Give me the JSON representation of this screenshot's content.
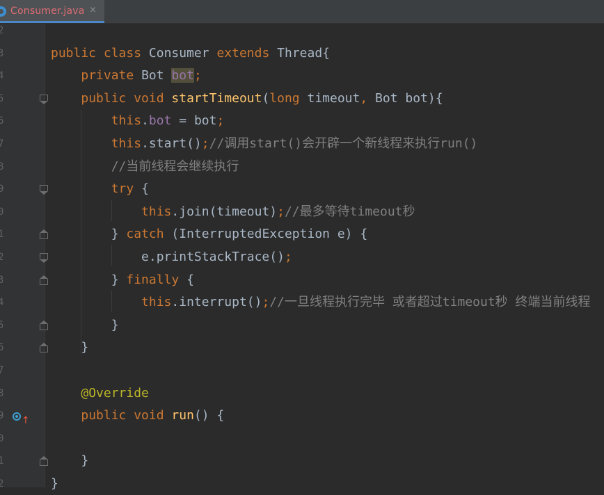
{
  "tab": {
    "label": "Consumer.java",
    "close": "×"
  },
  "lines": [
    {
      "num": "2",
      "html": ""
    },
    {
      "num": "3",
      "html": "<span class=\"kw\">public class </span><span class=\"cls\">Consumer </span><span class=\"kw\">extends </span><span class=\"ty\">Thread</span>{"
    },
    {
      "num": "4",
      "html": "    <span class=\"kw\">private </span><span class=\"ty\">Bot </span><span class=\"fld hl\">bot</span><span class=\"kw\">;</span>"
    },
    {
      "num": "5",
      "html": "    <span class=\"kw\">public void </span><span class=\"mth\">startTimeout</span>(<span class=\"kw\">long </span>timeout<span class=\"kw\">, </span><span class=\"ty\">Bot </span>bot){"
    },
    {
      "num": "6",
      "html": "        <span class=\"kw\">this</span>.<span class=\"fld\">bot </span>= bot<span class=\"kw\">;</span>"
    },
    {
      "num": "7",
      "html": "        <span class=\"kw\">this</span>.start()<span class=\"kw\">;</span><span class=\"cm\">//调用start()会开辟一个新线程来执行run()</span>"
    },
    {
      "num": "8",
      "html": "        <span class=\"cm\">//当前线程会继续执行</span>"
    },
    {
      "num": "9",
      "html": "        <span class=\"kw\">try </span>{"
    },
    {
      "num": "0",
      "html": "            <span class=\"kw\">this</span>.join(timeout)<span class=\"kw\">;</span><span class=\"cm\">//最多等待timeout秒</span>"
    },
    {
      "num": "1",
      "html": "        } <span class=\"kw\">catch </span>(<span class=\"ty\">InterruptedException </span>e) {"
    },
    {
      "num": "2",
      "html": "            e.printStackTrace()<span class=\"kw\">;</span>"
    },
    {
      "num": "3",
      "html": "        } <span class=\"kw\">finally </span>{"
    },
    {
      "num": "4",
      "html": "            <span class=\"kw\">this</span>.interrupt()<span class=\"kw\">;</span><span class=\"cm\">//一旦线程执行完毕 或者超过timeout秒 终端当前线程</span>"
    },
    {
      "num": "5",
      "html": "        }"
    },
    {
      "num": "6",
      "html": "    }"
    },
    {
      "num": "7",
      "html": ""
    },
    {
      "num": "8",
      "html": "    <span class=\"ann\">@Override</span>"
    },
    {
      "num": "9",
      "html": "    <span class=\"kw\">public void </span><span class=\"mth\">run</span>() {"
    },
    {
      "num": "0",
      "html": ""
    },
    {
      "num": "1",
      "html": "    }"
    },
    {
      "num": "2",
      "html": "}"
    }
  ],
  "folds": {
    "open": [
      3,
      7,
      10
    ],
    "close": [
      9,
      11,
      13,
      14,
      19
    ]
  },
  "override_line": 17,
  "colors": {
    "background": "#2b2b2b",
    "keyword": "#cc7832",
    "field": "#9876aa",
    "method": "#ffc66d",
    "comment": "#808080",
    "annotation": "#bbb529",
    "tab_accent": "#4a88c7"
  }
}
